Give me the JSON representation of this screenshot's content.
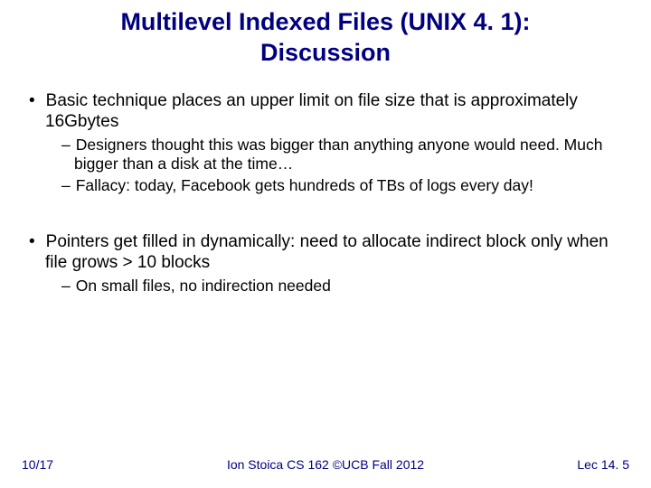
{
  "title_line1": "Multilevel Indexed Files (UNIX 4. 1):",
  "title_line2": "Discussion",
  "bullets": {
    "b1": "Basic technique places an upper limit on file size that is approximately 16Gbytes",
    "b1a": "Designers thought this was bigger than anything anyone would need.  Much bigger than a disk at the time…",
    "b1b": "Fallacy: today, Facebook gets hundreds of TBs of logs every day!",
    "b2": "Pointers get filled in dynamically: need to allocate indirect block only when file grows > 10 blocks",
    "b2a": "On small files, no indirection needed"
  },
  "footer": {
    "date": "10/17",
    "center": "Ion Stoica CS 162 ©UCB Fall 2012",
    "right": "Lec 14. 5"
  }
}
